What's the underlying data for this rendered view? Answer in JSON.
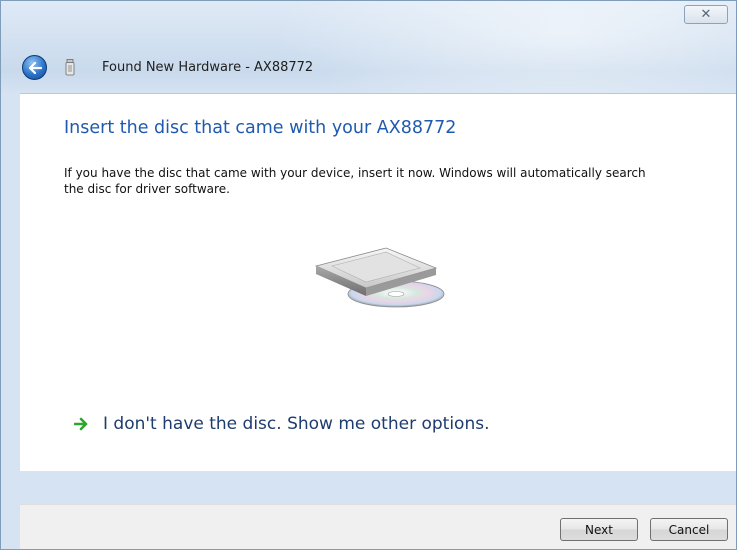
{
  "window": {
    "title": "Found New Hardware - AX88772",
    "close_glyph": "✕"
  },
  "content": {
    "heading": "Insert the disc that came with your AX88772",
    "body": "If you have the disc that came with your device, insert it now.  Windows will automatically search the disc for driver software.",
    "option_link": "I don't have the disc.  Show me other options."
  },
  "footer": {
    "next_label": "Next",
    "cancel_label": "Cancel"
  },
  "icons": {
    "back": "back-arrow-icon",
    "hardware": "usb-device-icon",
    "disc": "disc-drive-icon",
    "option_arrow": "green-arrow-icon"
  },
  "colors": {
    "heading": "#1f5ab0",
    "link_arrow": "#2fa52f"
  }
}
